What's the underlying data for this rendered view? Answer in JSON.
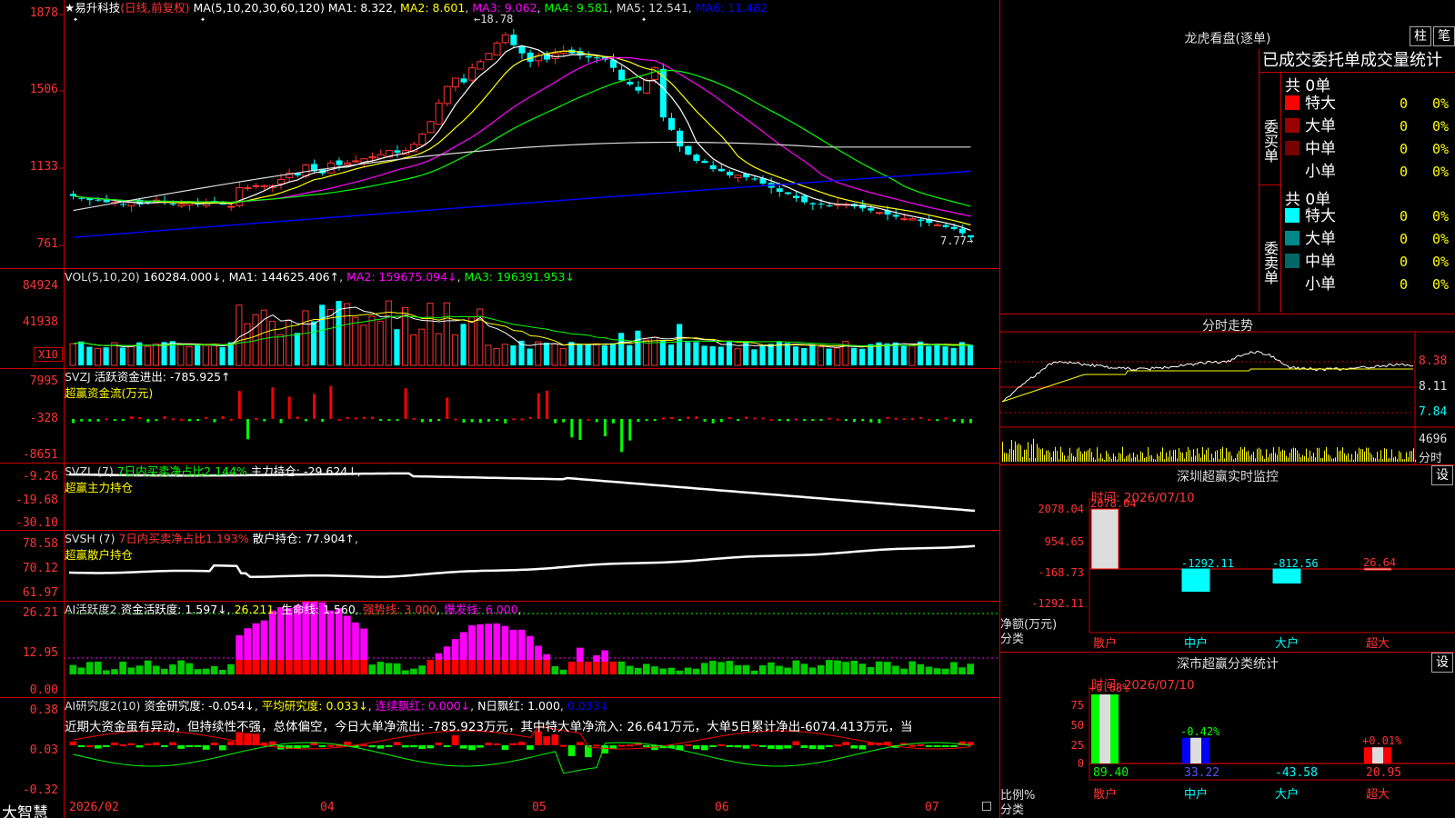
{
  "main": {
    "stock_name": "★易升科技",
    "mode": "(日线,前复权)",
    "ma_label": "MA(5,10,20,30,60,120)",
    "ma": [
      {
        "label": "MA1: 8.322",
        "color": "#ffffff"
      },
      {
        "label": "MA2: 8.601",
        "color": "#ffff00"
      },
      {
        "label": "MA3: 9.062",
        "color": "#ff00ff"
      },
      {
        "label": "MA4: 9.581",
        "color": "#00ff00"
      },
      {
        "label": "MA5: 12.541",
        "color": "#dddddd"
      },
      {
        "label": "MA6: 11.482",
        "color": "#0000ff"
      }
    ],
    "y_ticks": [
      "1878",
      "1506",
      "1133",
      "761"
    ],
    "high_label": "18.78",
    "low_label": "7.77"
  },
  "vol": {
    "label": "VOL(5,10,20)",
    "value": "160284.000↓",
    "ma1": "MA1: 144625.406↑",
    "ma2": "MA2: 159675.094↓",
    "ma3": "MA3: 196391.953↓",
    "y_ticks": [
      "84924",
      "41938"
    ],
    "multiplier": "X10"
  },
  "svzj": {
    "label": "SVZJ",
    "text": "活跃资金进出: -785.925↑",
    "sub": "超赢资金流(万元)",
    "y_ticks": [
      "7995",
      "-328",
      "-8651"
    ]
  },
  "svzl": {
    "label": "SVZL (7)",
    "text1": "7日内买卖净占比2.144%",
    "text2": "主力持仓: -29.624↓",
    "sub": "超赢主力持仓",
    "y_ticks": [
      "-9.26",
      "-19.68",
      "-30.10"
    ]
  },
  "svsh": {
    "label": "SVSH (7)",
    "text1": "7日内买卖净占比1.193%",
    "text2": "散户持仓: 77.904↑",
    "sub": "超赢散户持仓",
    "y_ticks": [
      "78.58",
      "70.12",
      "61.97"
    ]
  },
  "ai1": {
    "label": "AI活跃度2",
    "t1": "资金活跃度: 1.597↓",
    "t2": "26.211",
    "t3": "生命线: 1.560",
    "t4": "强势线: 3.000",
    "t5": "爆发线: 6.000",
    "y_ticks": [
      "26.21",
      "12.95",
      "0.00"
    ]
  },
  "ai2": {
    "label": "AI研究度2(10)",
    "t1": "资金研究度: -0.054↓",
    "t2": "平均研究度: 0.033↓",
    "t3": "连续飘红: 0.000↓",
    "t4": "N日飘红: 1.000",
    "t5": "0.033↓",
    "comment": "近期大资金虽有异动，但持续性不强，总体偏空，今日大单净流出: -785.923万元，其中特大单净流入: 26.641万元，大单5日累计净出-6074.413万元，当",
    "y_ticks": [
      "0.38",
      "0.03",
      "-0.32"
    ]
  },
  "xaxis": {
    "brand": "大智慧",
    "ticks": [
      "2026/02",
      "04",
      "05",
      "06",
      "07"
    ]
  },
  "dragon": {
    "title": "龙虎看盘(逐单)",
    "btn1": "柱",
    "btn2": "笔",
    "subtitle": "已成交委托单成交量统计",
    "buy": {
      "side": "委买单",
      "total": "共 0单",
      "rows": [
        {
          "name": "特大",
          "count": "0",
          "pct": "0%",
          "color": "#ff0000"
        },
        {
          "name": "大单",
          "count": "0",
          "pct": "0%",
          "color": "#990000"
        },
        {
          "name": "中单",
          "count": "0",
          "pct": "0%",
          "color": "#770000"
        },
        {
          "name": "小单",
          "count": "0",
          "pct": "0%",
          "color": "#000000"
        }
      ]
    },
    "sell": {
      "side": "委卖单",
      "total": "共 0单",
      "rows": [
        {
          "name": "特大",
          "count": "0",
          "pct": "0%",
          "color": "#00ffff"
        },
        {
          "name": "大单",
          "count": "0",
          "pct": "0%",
          "color": "#008888"
        },
        {
          "name": "中单",
          "count": "0",
          "pct": "0%",
          "color": "#006666"
        },
        {
          "name": "小单",
          "count": "0",
          "pct": "0%",
          "color": "#000000"
        }
      ]
    }
  },
  "intraday": {
    "title": "分时走势",
    "prices": [
      "8.38",
      "8.11",
      "7.84"
    ],
    "vol": "4696",
    "fenshi": "分时"
  },
  "monitor": {
    "title": "深圳超赢实时监控",
    "btn": "设",
    "time": "时间: 2026/07/10",
    "y_ticks": [
      "2078.04",
      "954.65",
      "-168.73",
      "-1292.11"
    ],
    "unit": "净额(万元)",
    "cat_label": "分类",
    "bars": [
      {
        "cat": "散户",
        "value": 2078.04,
        "label": "2078.04"
      },
      {
        "cat": "中户",
        "value": -1292.11,
        "label": "-1292.11"
      },
      {
        "cat": "大户",
        "value": -812.56,
        "label": "-812.56"
      },
      {
        "cat": "超大",
        "value": 26.64,
        "label": "26.64"
      }
    ]
  },
  "stats": {
    "title": "深市超赢分类统计",
    "btn": "设",
    "time": "时间: 2026/07/10",
    "y_ticks": [
      "75",
      "50",
      "25",
      "0"
    ],
    "unit": "比例%",
    "cat_label": "分类",
    "bars": [
      {
        "cat": "散户",
        "value": 89.4,
        "change": "+0.68%",
        "color": "#00ff00"
      },
      {
        "cat": "中户",
        "value": 33.22,
        "change": "-0.42%",
        "color": "#0000ff"
      },
      {
        "cat": "大户",
        "value": -43.58,
        "change": "",
        "color": "#00ffff"
      },
      {
        "cat": "超大",
        "value": 20.95,
        "change": "+0.01%",
        "color": "#ff0000"
      }
    ]
  },
  "chart_data": {
    "type": "candlestick",
    "y_range": [
      7.61,
      18.78
    ],
    "candles_close": [
      10.0,
      9.9,
      9.8,
      9.8,
      9.7,
      9.7,
      9.6,
      9.7,
      9.6,
      9.7,
      9.8,
      9.7,
      9.6,
      9.6,
      9.7,
      9.6,
      9.7,
      9.7,
      9.6,
      9.5,
      10.4,
      10.4,
      10.5,
      10.5,
      10.5,
      10.8,
      11.1,
      11.0,
      11.5,
      11.2,
      11.1,
      11.6,
      11.5,
      11.6,
      11.7,
      11.8,
      11.9,
      12.0,
      12.2,
      12.1,
      12.2,
      12.5,
      13.0,
      13.6,
      14.5,
      15.3,
      15.7,
      15.5,
      16.2,
      16.5,
      16.9,
      17.4,
      17.8,
      17.3,
      16.9,
      16.5,
      16.8,
      16.6,
      16.9,
      17.0,
      16.9,
      16.8,
      16.7,
      16.7,
      16.6,
      16.2,
      15.6,
      15.4,
      15.1,
      15.6,
      16.2,
      13.8,
      13.2,
      12.4,
      12.0,
      11.7,
      11.6,
      11.3,
      11.2,
      11.0,
      11.0,
      10.9,
      10.8,
      10.6,
      10.4,
      10.2,
      10.1,
      9.9,
      9.7,
      9.6,
      9.6,
      9.5,
      9.6,
      9.6,
      9.5,
      9.4,
      9.3,
      9.2,
      9.1,
      9.0,
      8.9,
      8.9,
      8.8,
      8.7,
      8.6,
      8.5,
      8.4,
      8.2,
      8.0
    ]
  }
}
